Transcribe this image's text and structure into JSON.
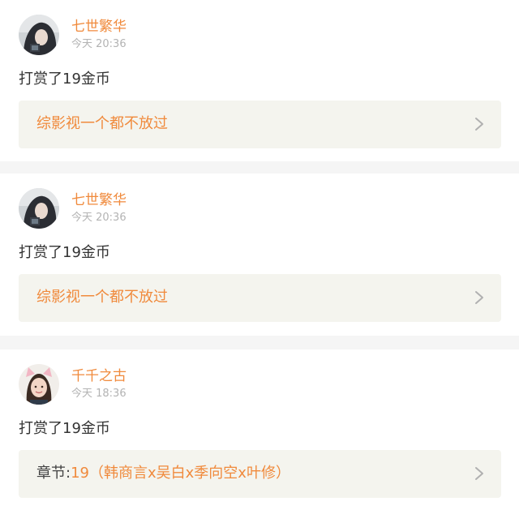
{
  "colors": {
    "accent": "#f08a3c",
    "text": "#333333",
    "muted": "#b3b3b3",
    "link_bg": "#f4f4ee",
    "separator": "#f5f5f5"
  },
  "posts": [
    {
      "username": "七世繁华",
      "time": "今天 20:36",
      "action": "打赏了19金币",
      "link": {
        "prefix": "",
        "text": "综影视一个都不放过"
      },
      "avatar_icon": "avatar-dark-hair"
    },
    {
      "username": "七世繁华",
      "time": "今天 20:36",
      "action": "打赏了19金币",
      "link": {
        "prefix": "",
        "text": "综影视一个都不放过"
      },
      "avatar_icon": "avatar-dark-hair"
    },
    {
      "username": "千千之古",
      "time": "今天 18:36",
      "action": "打赏了19金币",
      "link": {
        "prefix": "章节:",
        "text": "19（韩商言x吴白x季向空x叶修）"
      },
      "avatar_icon": "avatar-cat-ears"
    }
  ]
}
